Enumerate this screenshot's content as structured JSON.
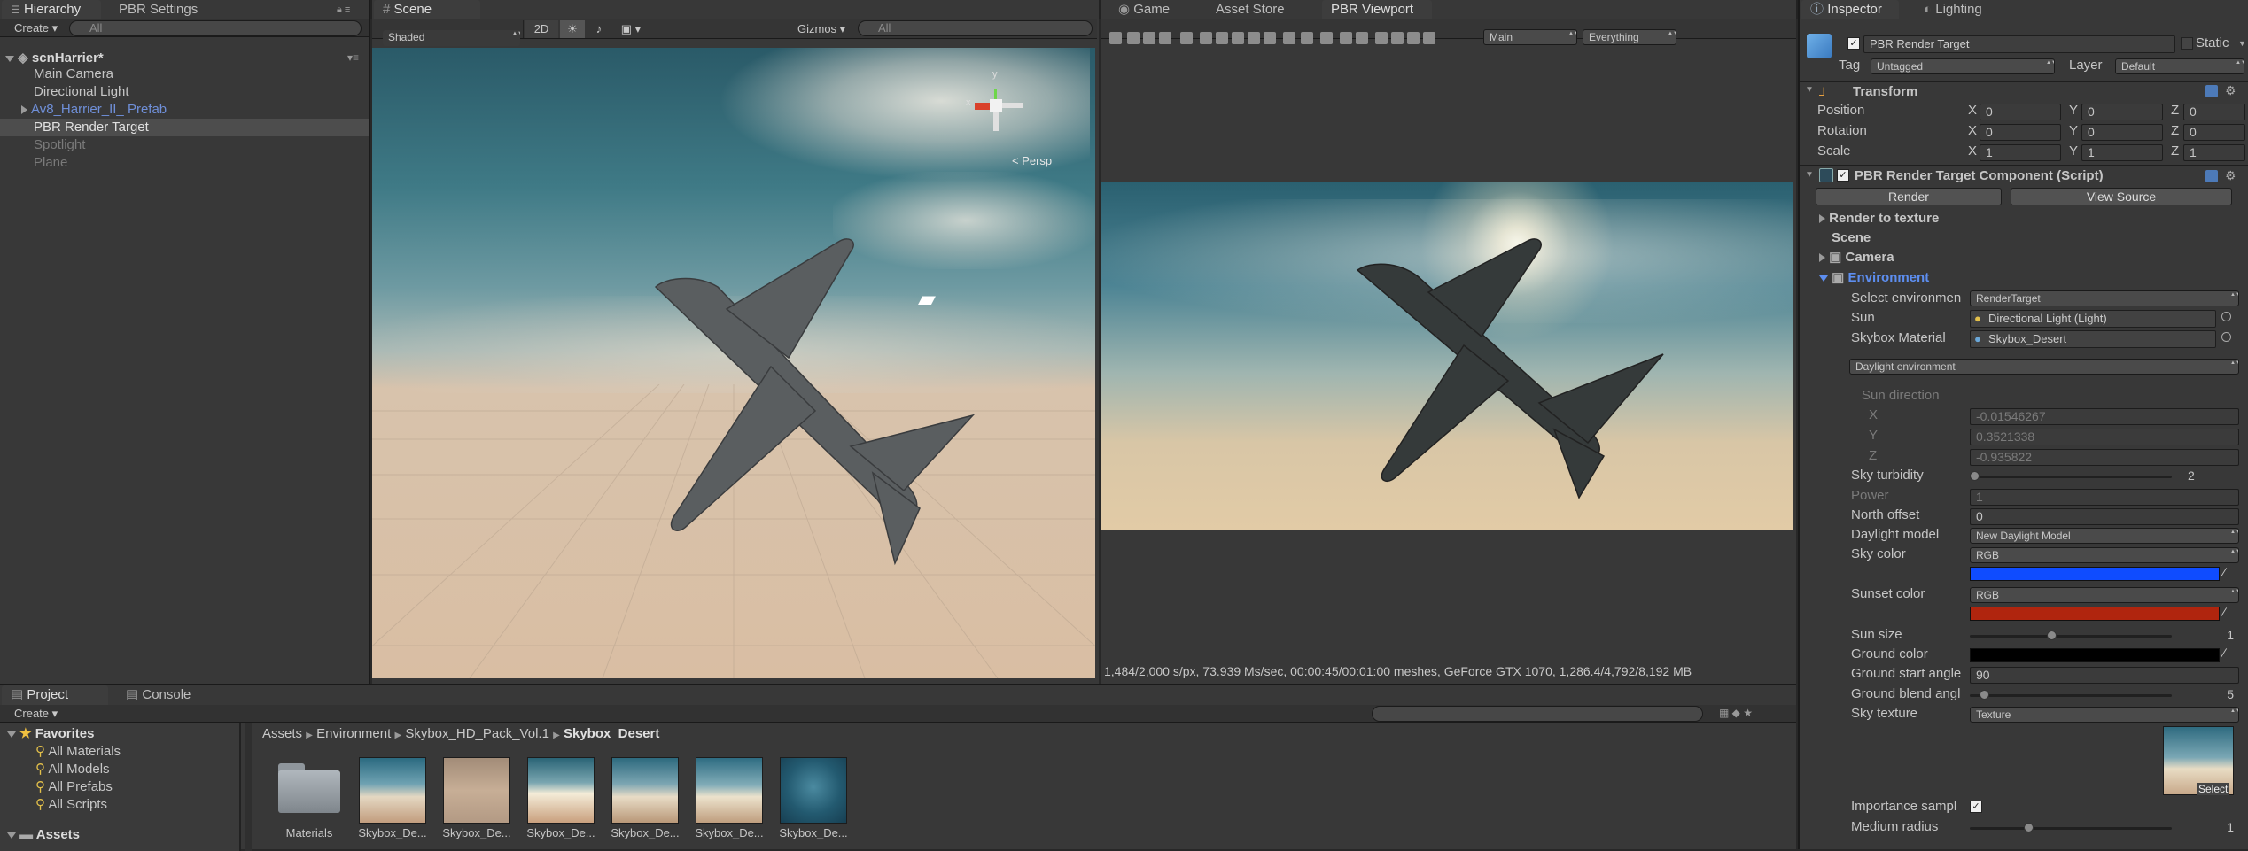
{
  "hierarchy": {
    "tab": "Hierarchy",
    "tab2": "PBR Settings",
    "create": "Create ▾",
    "search_placeholder": "All",
    "scene_name": "scnHarrier*",
    "items": [
      "Main Camera",
      "Directional Light",
      "Av8_Harrier_II_ Prefab",
      "PBR Render Target",
      "Spotlight",
      "Plane"
    ]
  },
  "scene": {
    "tab": "Scene",
    "shading": "Shaded",
    "mode2d": "2D",
    "gizmos": "Gizmos ▾",
    "search_placeholder": "All",
    "persp": "< Persp",
    "axis_x": "x",
    "axis_y": "y"
  },
  "game": {
    "tab": "Game",
    "tab2": "Asset Store",
    "tab3": "PBR Viewport",
    "camera_select": "Main",
    "layers_select": "Everything",
    "status": "1,484/2,000 s/px, 73.939 Ms/sec, 00:00:45/00:01:00   meshes, GeForce GTX 1070, 1,286.4/4,792/8,192 MB"
  },
  "inspector": {
    "tab": "Inspector",
    "tab2": "Lighting",
    "object_name": "PBR Render Target",
    "static_label": "Static",
    "tag_label": "Tag",
    "tag_value": "Untagged",
    "layer_label": "Layer",
    "layer_value": "Default",
    "transform": {
      "title": "Transform",
      "rows": [
        {
          "label": "Position",
          "x": "0",
          "y": "0",
          "z": "0"
        },
        {
          "label": "Rotation",
          "x": "0",
          "y": "0",
          "z": "0"
        },
        {
          "label": "Scale",
          "x": "1",
          "y": "1",
          "z": "1"
        }
      ],
      "x": "X",
      "y": "Y",
      "z": "Z"
    },
    "component": {
      "title": "PBR Render Target Component (Script)",
      "render_btn": "Render",
      "view_source_btn": "View Source",
      "render_to_texture": "Render to texture",
      "scene_label": "Scene",
      "camera_label": "Camera",
      "environment_label": "Environment",
      "select_env_label": "Select environmen",
      "select_env_value": "RenderTarget",
      "sun_label": "Sun",
      "sun_value": "Directional Light (Light)",
      "skybox_label": "Skybox Material",
      "skybox_value": "Skybox_Desert",
      "daylight_env": "Daylight environment",
      "sun_direction": "Sun direction",
      "sun_x_label": "X",
      "sun_x": "-0.01546267",
      "sun_y_label": "Y",
      "sun_y": "0.3521338",
      "sun_z_label": "Z",
      "sun_z": "-0.935822",
      "sky_turbidity_label": "Sky turbidity",
      "sky_turbidity": "2",
      "sky_turbidity_frac": 0.0,
      "power_label": "Power",
      "power": "1",
      "north_offset_label": "North offset",
      "north_offset": "0",
      "daylight_model_label": "Daylight model",
      "daylight_model": "New Daylight Model",
      "sky_color_label": "Sky color",
      "sky_color_mode": "RGB",
      "sky_color": "#0f4cff",
      "sunset_color_label": "Sunset color",
      "sunset_color_mode": "RGB",
      "sunset_color": "#b0250e",
      "sun_size_label": "Sun size",
      "sun_size": "1",
      "sun_size_frac": 0.4,
      "ground_color_label": "Ground color",
      "ground_color": "#000000",
      "ground_start_label": "Ground start angle",
      "ground_start": "90",
      "ground_blend_label": "Ground blend angl",
      "ground_blend": "5",
      "ground_blend_frac": 0.05,
      "sky_texture_label": "Sky texture",
      "sky_texture": "Texture",
      "select_label": "Select",
      "importance_label": "Importance sampl",
      "medium_radius_label": "Medium radius",
      "medium_radius": "1",
      "medium_radius_frac": 0.28
    }
  },
  "project": {
    "tab": "Project",
    "tab2": "Console",
    "create": "Create ▾",
    "favorites": "Favorites",
    "fav_items": [
      "All Materials",
      "All Models",
      "All Prefabs",
      "All Scripts"
    ],
    "assets": "Assets",
    "breadcrumb": [
      "Assets",
      "Environment",
      "Skybox_HD_Pack_Vol.1",
      "Skybox_Desert"
    ],
    "asset_items": [
      "Materials",
      "Skybox_De...",
      "Skybox_De...",
      "Skybox_De...",
      "Skybox_De...",
      "Skybox_De...",
      "Skybox_De..."
    ]
  }
}
